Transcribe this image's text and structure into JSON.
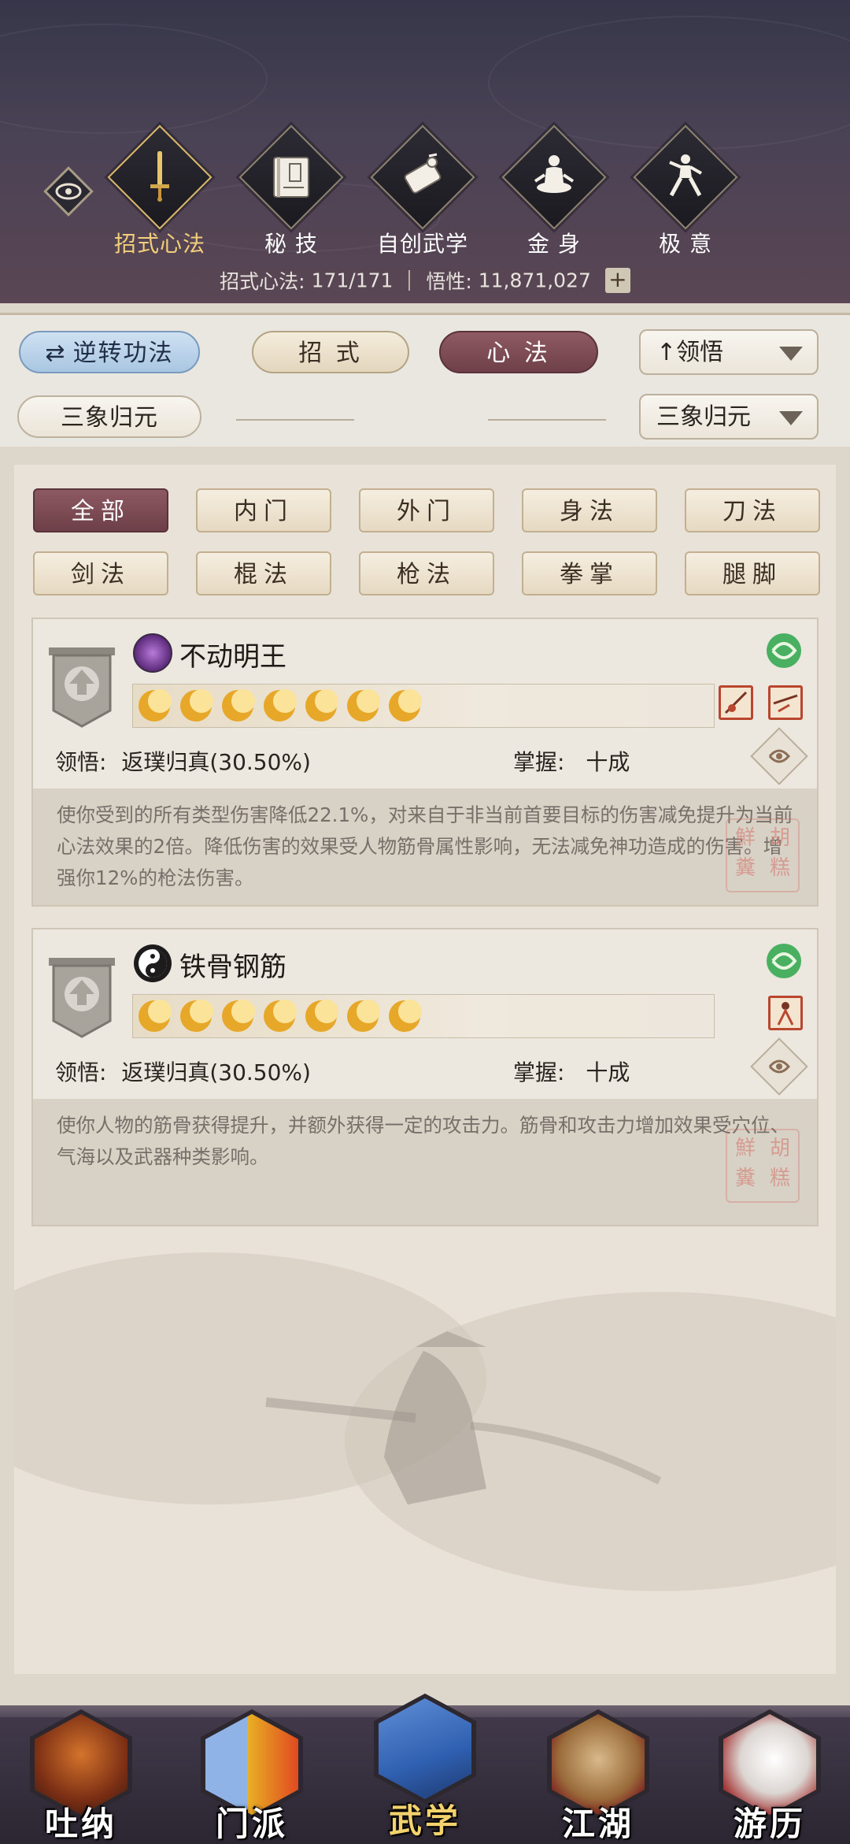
{
  "header": {
    "tabs": [
      {
        "label": "招式心法",
        "icon": "sword-icon",
        "selected": true
      },
      {
        "label": "秘 技",
        "icon": "book-icon",
        "selected": false
      },
      {
        "label": "自创武学",
        "icon": "scroll-icon",
        "selected": false
      },
      {
        "label": "金 身",
        "icon": "meditating-figure-icon",
        "selected": false
      },
      {
        "label": "极 意",
        "icon": "martial-pose-icon",
        "selected": false
      }
    ],
    "stats": {
      "moves_label": "招式心法:",
      "moves_value": "171/171",
      "insight_label": "悟性:",
      "insight_value": "11,871,027",
      "plus": "+"
    }
  },
  "toolbar": {
    "reverse_label": "逆转功法",
    "tab_moves": "招 式",
    "tab_heart": "心 法",
    "sort_label": "领悟",
    "sort_arrow": "↑",
    "tag_label": "三象归元",
    "filter_select": "三象归元"
  },
  "filters": [
    {
      "label": "全部",
      "selected": true
    },
    {
      "label": "内门",
      "selected": false
    },
    {
      "label": "外门",
      "selected": false
    },
    {
      "label": "身法",
      "selected": false
    },
    {
      "label": "刀法",
      "selected": false
    },
    {
      "label": "剑法",
      "selected": false
    },
    {
      "label": "棍法",
      "selected": false
    },
    {
      "label": "枪法",
      "selected": false
    },
    {
      "label": "拳掌",
      "selected": false
    },
    {
      "label": "腿脚",
      "selected": false
    }
  ],
  "skills": [
    {
      "name": "不动明王",
      "icon": "purple-orb-icon",
      "moons": 7,
      "insight_label": "领悟:",
      "insight_value": "返璞归真(30.50%)",
      "mastery_label": "掌握:",
      "mastery_value": "十成",
      "description": "使你受到的所有类型伤害降低22.1%，对来自于非当前首要目标的伤害减免提升为当前心法效果的2倍。降低伤害的效果受人物筋骨属性影响，无法减免神功造成的伤害。增强你12%的枪法伤害。",
      "sub_icons": [
        "spear-art-icon",
        "spear-strike-icon"
      ],
      "seal_chars": [
        "胡",
        "糕",
        "鮮",
        "糞"
      ]
    },
    {
      "name": "铁骨钢筋",
      "icon": "yin-yang-icon",
      "moons": 7,
      "insight_label": "领悟:",
      "insight_value": "返璞归真(30.50%)",
      "mastery_label": "掌握:",
      "mastery_value": "十成",
      "description": "使你人物的筋骨获得提升，并额外获得一定的攻击力。筋骨和攻击力增加效果受穴位、气海以及武器种类影响。",
      "sub_icons": [
        "body-art-icon"
      ],
      "seal_chars": [
        "胡",
        "糕",
        "鮮",
        "糞"
      ]
    }
  ],
  "bottom_nav": [
    {
      "label": "吐纳",
      "icon": "monk-icon",
      "selected": false
    },
    {
      "label": "门派",
      "icon": "sect-banner-icon",
      "selected": false
    },
    {
      "label": "武学",
      "icon": "martial-book-icon",
      "selected": true
    },
    {
      "label": "江湖",
      "icon": "straw-hat-icon",
      "selected": false
    },
    {
      "label": "游历",
      "icon": "white-horse-icon",
      "selected": false
    }
  ]
}
